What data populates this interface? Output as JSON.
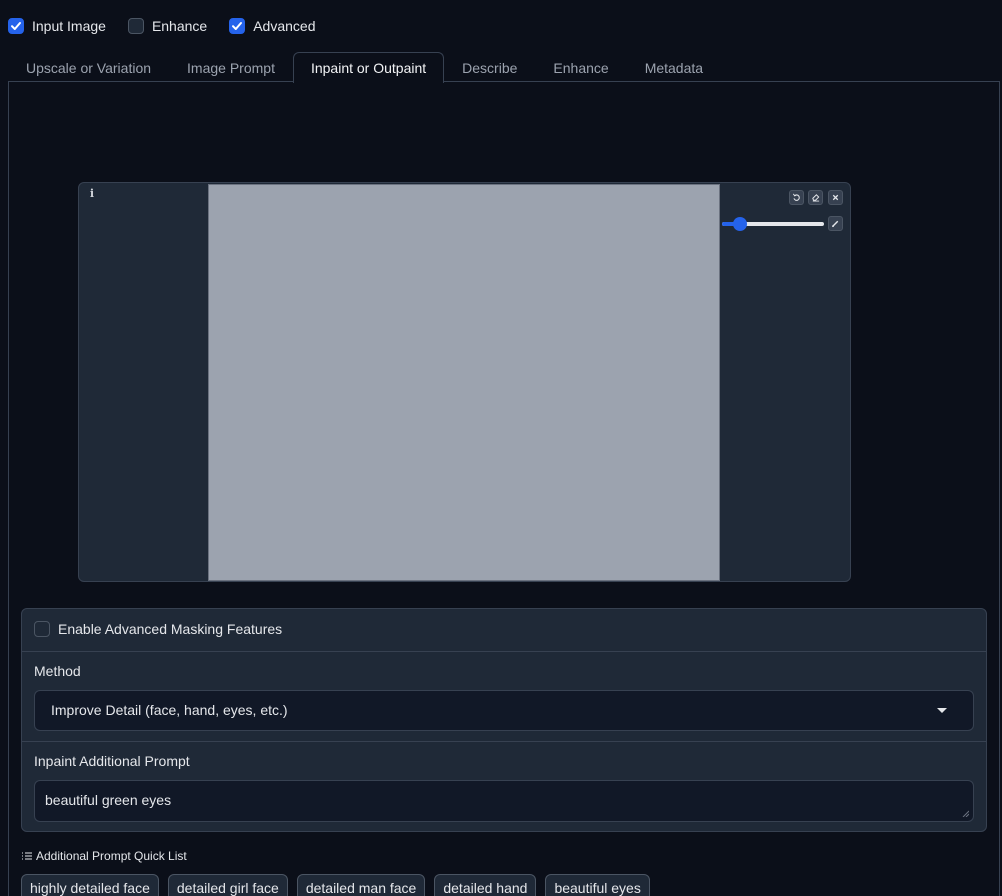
{
  "topbar": {
    "checkboxes": [
      {
        "label": "Input Image",
        "checked": true
      },
      {
        "label": "Enhance",
        "checked": false
      },
      {
        "label": "Advanced",
        "checked": true
      }
    ]
  },
  "tabs": [
    {
      "label": "Upscale or Variation",
      "active": false
    },
    {
      "label": "Image Prompt",
      "active": false
    },
    {
      "label": "Inpaint or Outpaint",
      "active": true
    },
    {
      "label": "Describe",
      "active": false
    },
    {
      "label": "Enhance",
      "active": false
    },
    {
      "label": "Metadata",
      "active": false
    }
  ],
  "editor": {
    "info_icon": "info-icon",
    "brush_size": 0.12,
    "tools": [
      "undo-icon",
      "eraser-icon",
      "close-icon"
    ],
    "color_tool": "brush-color-icon"
  },
  "masking": {
    "enable_label": "Enable Advanced Masking Features",
    "enable_checked": false,
    "method_label": "Method",
    "method_value": "Improve Detail (face, hand, eyes, etc.)",
    "prompt_label": "Inpaint Additional Prompt",
    "prompt_value": "beautiful green eyes"
  },
  "quick_list": {
    "label": "Additional Prompt Quick List",
    "items": [
      "highly detailed face",
      "detailed girl face",
      "detailed man face",
      "detailed hand",
      "beautiful eyes"
    ]
  },
  "colors": {
    "background": "#0b0f19",
    "panel": "#1f2937",
    "accent": "#2563eb",
    "border": "#374151"
  }
}
